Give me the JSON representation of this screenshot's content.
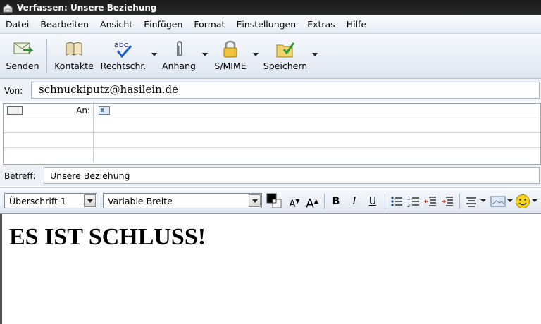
{
  "window": {
    "title": "Verfassen: Unsere Beziehung"
  },
  "menu": [
    "Datei",
    "Bearbeiten",
    "Ansicht",
    "Einfügen",
    "Format",
    "Einstellungen",
    "Extras",
    "Hilfe"
  ],
  "toolbar": {
    "send": "Senden",
    "contacts": "Kontakte",
    "spell": "Rechtschr.",
    "spell_icon_text": "abc",
    "attach": "Anhang",
    "smime": "S/MIME",
    "save": "Speichern"
  },
  "header": {
    "from_label": "Von:",
    "from_value": "schnuckiputz@hasilein.de",
    "to_label": "An:",
    "subject_label": "Betreff:",
    "subject_value": "Unsere Beziehung"
  },
  "format": {
    "paragraph_style": "Überschrift 1",
    "font": "Variable Breite",
    "bold": "B",
    "italic": "I",
    "underline": "U",
    "text_color": "#000000"
  },
  "body": {
    "heading": "ES IST SCHLUSS!"
  }
}
